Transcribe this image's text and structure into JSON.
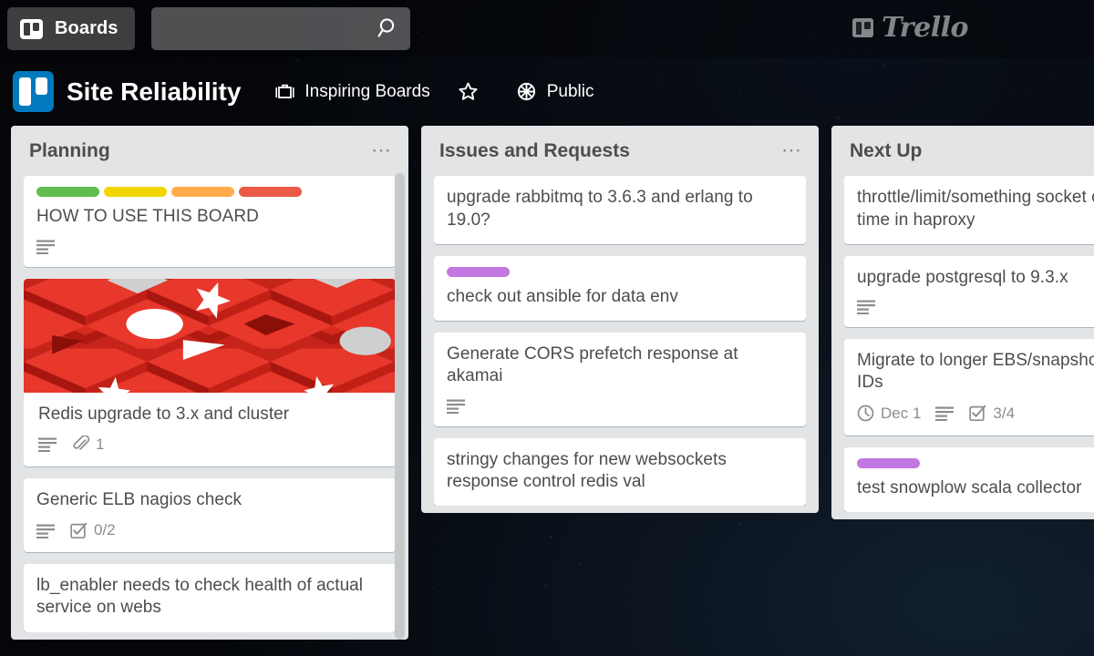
{
  "app": {
    "name": "Trello",
    "logo_wordmark": "Trello",
    "logo_icon": "trello-board-icon"
  },
  "top_bar": {
    "boards_button": {
      "label": "Boards",
      "icon": "board-icon"
    },
    "search": {
      "value": "",
      "placeholder": "",
      "icon": "search-icon"
    }
  },
  "board_header": {
    "logo_icon": "trello-board-icon",
    "title": "Site Reliability",
    "organization": {
      "label": "Inspiring Boards",
      "icon": "briefcase-icon"
    },
    "star": {
      "label": "",
      "icon": "star-outline-icon"
    },
    "visibility": {
      "label": "Public",
      "icon": "globe-icon"
    }
  },
  "colors": {
    "label_green": "#61bd4f",
    "label_yellow": "#f2d600",
    "label_orange": "#ffab4a",
    "label_red": "#eb5a46",
    "label_purple": "#c377e0",
    "list_background": "#e2e4e6",
    "card_background": "#ffffff",
    "text_primary": "#4d4d4d",
    "text_muted": "#8c8c8c",
    "brand_blue": "#0079bf",
    "board_background": "#04060a",
    "cover_red": "#d52b1e"
  },
  "lists": [
    {
      "title": "Planning",
      "menu_icon": "ellipsis-icon",
      "has_scrollbar": true,
      "cards": [
        {
          "title": "HOW TO USE THIS BOARD",
          "labels": [
            "#61bd4f",
            "#f2d600",
            "#ffab4a",
            "#eb5a46"
          ],
          "cover": null,
          "badges": [
            {
              "type": "description",
              "icon": "description-icon",
              "text": ""
            }
          ]
        },
        {
          "title": "Redis upgrade to 3.x and cluster",
          "labels": [],
          "cover": "red-isometric-pattern",
          "badges": [
            {
              "type": "description",
              "icon": "description-icon",
              "text": ""
            },
            {
              "type": "attachment",
              "icon": "paperclip-icon",
              "text": "1"
            }
          ]
        },
        {
          "title": "Generic ELB nagios check",
          "labels": [],
          "cover": null,
          "badges": [
            {
              "type": "description",
              "icon": "description-icon",
              "text": ""
            },
            {
              "type": "checklist",
              "icon": "checklist-icon",
              "text": "0/2"
            }
          ]
        },
        {
          "title": "lb_enabler needs to check health of actual service on webs",
          "labels": [],
          "cover": null,
          "badges": []
        }
      ]
    },
    {
      "title": "Issues and Requests",
      "menu_icon": "ellipsis-icon",
      "has_scrollbar": false,
      "cards": [
        {
          "title": "upgrade rabbitmq to 3.6.3 and erlang to 19.0?",
          "labels": [],
          "cover": null,
          "badges": []
        },
        {
          "title": "check out ansible for data env",
          "labels": [
            "#c377e0"
          ],
          "cover": null,
          "badges": []
        },
        {
          "title": "Generate CORS prefetch response at akamai",
          "labels": [],
          "cover": null,
          "badges": [
            {
              "type": "description",
              "icon": "description-icon",
              "text": ""
            }
          ]
        },
        {
          "title": "stringy changes for new websockets response control redis val",
          "labels": [],
          "cover": null,
          "badges": []
        }
      ]
    },
    {
      "title": "Next Up",
      "menu_icon": "ellipsis-icon",
      "has_scrollbar": false,
      "cards": [
        {
          "title": "throttle/limit/something socket connects per time in haproxy",
          "labels": [],
          "cover": null,
          "badges": []
        },
        {
          "title": "upgrade postgresql to 9.3.x",
          "labels": [],
          "cover": null,
          "badges": [
            {
              "type": "description",
              "icon": "description-icon",
              "text": ""
            }
          ]
        },
        {
          "title": "Migrate to longer EBS/snapshot resources IDs",
          "labels": [],
          "cover": null,
          "badges": [
            {
              "type": "due-date",
              "icon": "clock-icon",
              "text": "Dec 1"
            },
            {
              "type": "description",
              "icon": "description-icon",
              "text": ""
            },
            {
              "type": "checklist",
              "icon": "checklist-icon",
              "text": "3/4"
            }
          ]
        },
        {
          "title": "test snowplow scala collector",
          "labels": [
            "#c377e0"
          ],
          "cover": null,
          "badges": []
        }
      ]
    }
  ]
}
